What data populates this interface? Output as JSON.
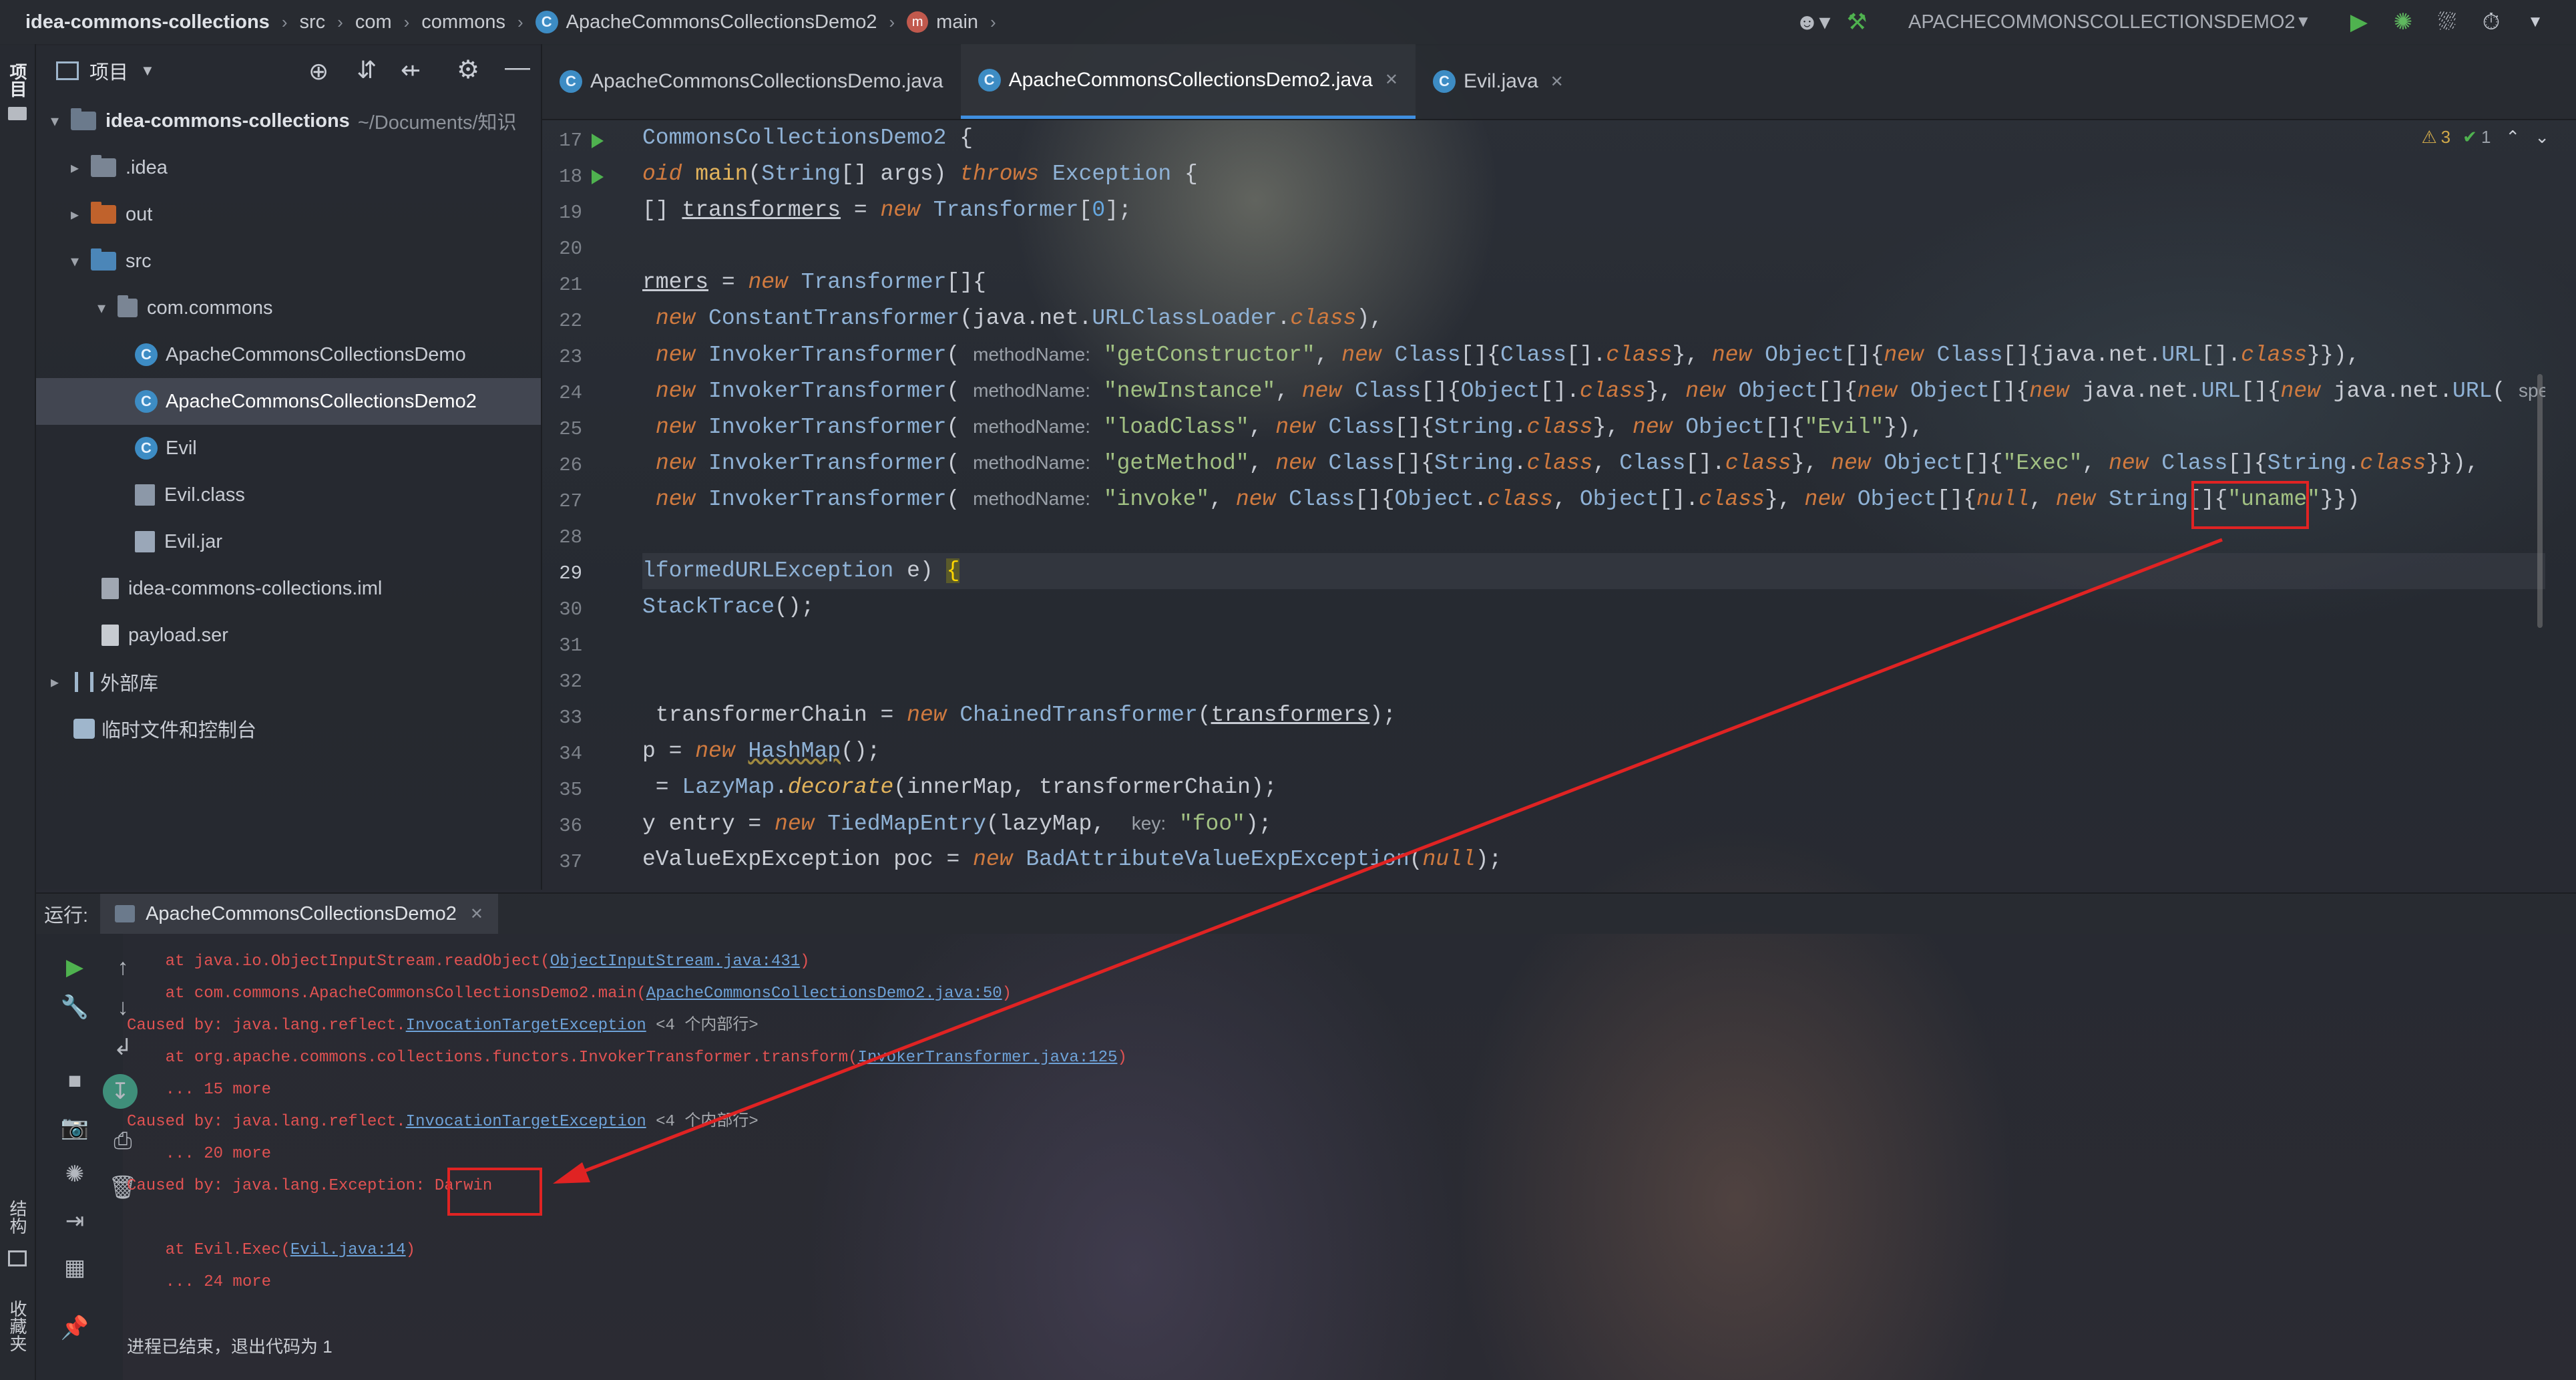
{
  "navbar": {
    "crumbs": [
      "idea-commons-collections",
      "src",
      "com",
      "commons",
      "ApacheCommonsCollectionsDemo2",
      "main"
    ],
    "run_config": "APACHECOMMONSCOLLECTIONSDEMO2"
  },
  "left_strip": {
    "project_label": "项目",
    "structure_label": "结构",
    "favorites_label": "收藏夹"
  },
  "project_panel": {
    "title": "项目",
    "tree": [
      {
        "label": "idea-commons-collections",
        "suffix": "~/Documents/知识",
        "icon": "folder-icon"
      },
      {
        "label": ".idea",
        "icon": "folder-icon"
      },
      {
        "label": "out",
        "icon": "folder-icon"
      },
      {
        "label": "src",
        "icon": "folder-icon"
      },
      {
        "label": "com.commons",
        "icon": "package-icon"
      },
      {
        "label": "ApacheCommonsCollectionsDemo",
        "icon": "class-icon"
      },
      {
        "label": "ApacheCommonsCollectionsDemo2",
        "icon": "class-icon"
      },
      {
        "label": "Evil",
        "icon": "class-icon"
      },
      {
        "label": "Evil.class",
        "icon": "class-file-icon"
      },
      {
        "label": "Evil.jar",
        "icon": "jar-icon"
      },
      {
        "label": "idea-commons-collections.iml",
        "icon": "file-icon"
      },
      {
        "label": "payload.ser",
        "icon": "file-icon"
      },
      {
        "label": "外部库",
        "icon": "library-icon"
      },
      {
        "label": "临时文件和控制台",
        "icon": "scratch-icon"
      }
    ]
  },
  "editor": {
    "tabs": [
      {
        "label": "ApacheCommonsCollectionsDemo.java"
      },
      {
        "label": "ApacheCommonsCollectionsDemo2.java"
      },
      {
        "label": "Evil.java"
      }
    ],
    "line_numbers": [
      "17",
      "18",
      "19",
      "20",
      "21",
      "22",
      "23",
      "24",
      "25",
      "26",
      "27",
      "28",
      "29",
      "30",
      "31",
      "32",
      "33",
      "34",
      "35",
      "36",
      "37"
    ],
    "warnings": {
      "warn_count": "3",
      "ok_count": "1"
    },
    "hints": {
      "method_name": "methodName:",
      "key": "key:",
      "spec": "spec:"
    },
    "strings": {
      "get_constructor": "\"getConstructor\"",
      "new_instance": "\"newInstance\"",
      "load_class": "\"loadClass\"",
      "evil": "\"Evil\"",
      "get_method": "\"getMethod\"",
      "exec": "\"Exec\"",
      "invoke": "\"invoke\"",
      "uname": "\"uname\"",
      "foo": "\"foo\""
    }
  },
  "run_panel": {
    "label": "运行:",
    "tab": "ApacheCommonsCollectionsDemo2",
    "console": {
      "l1_pre": "    at java.io.ObjectInputStream.readObject(",
      "l1_link": "ObjectInputStream.java:431",
      "l1_post": ")",
      "l2_pre": "    at com.commons.ApacheCommonsCollectionsDemo2.main(",
      "l2_link": "ApacheCommonsCollectionsDemo2.java:50",
      "l2_post": ")",
      "l3_pre": "Caused by: java.lang.reflect.",
      "l3_link": "InvocationTargetException",
      "l3_post": " <4 个内部行>",
      "l4_pre": "    at org.apache.commons.collections.functors.InvokerTransformer.transform(",
      "l4_link": "InvokerTransformer.java:125",
      "l4_post": ")",
      "l5": "    ... 15 more",
      "l6_pre": "Caused by: java.lang.reflect.",
      "l6_link": "InvocationTargetException",
      "l6_post": " <4 个内部行>",
      "l7": "    ... 20 more",
      "l8_pre": "Caused by: java.lang.Exception: ",
      "l8_value": "Darwin",
      "l9_pre": "    at Evil.Exec(",
      "l9_link": "Evil.java:14",
      "l9_post": ")",
      "l10": "    ... 24 more",
      "exit": "进程已结束，退出代码为 1"
    }
  },
  "colors": {
    "accent": "#3f8fe0",
    "error_text": "#e05252",
    "highlight_box": "#e02323",
    "run_green": "#4fb24f"
  }
}
